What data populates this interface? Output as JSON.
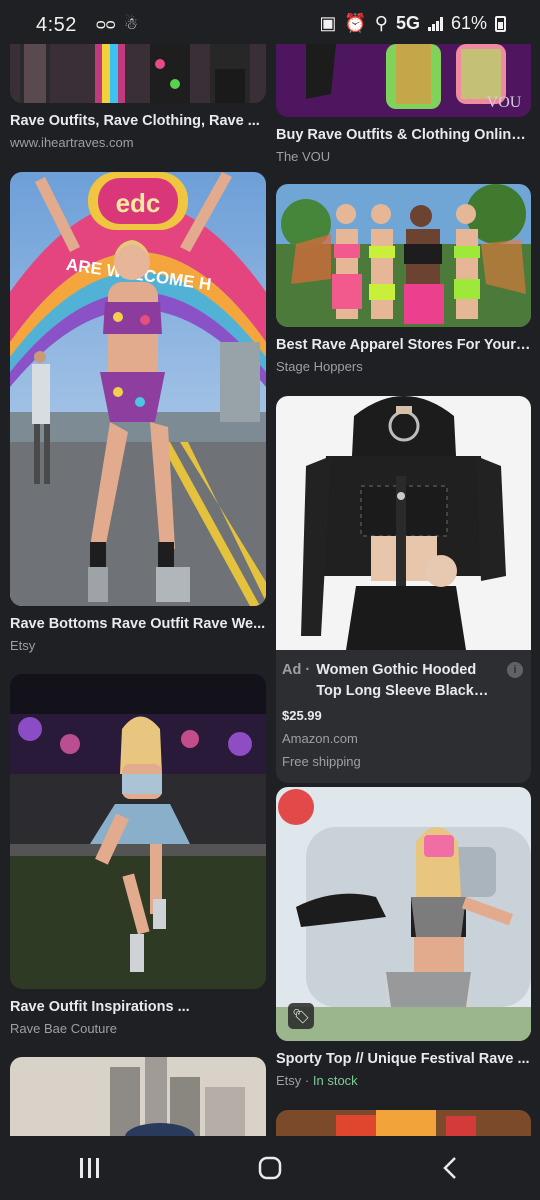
{
  "status_bar": {
    "time": "4:52",
    "network": "5G",
    "battery": "61%",
    "left_icons": [
      "voicemail-icon",
      "notification-icon"
    ],
    "right_icons": [
      "photo-icon",
      "alarm-icon",
      "location-icon",
      "signal-icon",
      "battery-icon"
    ]
  },
  "results": {
    "left": [
      {
        "title": "Rave Outfits, Rave Clothing, Rave ...",
        "source": "www.iheartraves.com"
      },
      {
        "title": "Rave Bottoms Rave Outfit Rave We...",
        "source": "Etsy"
      },
      {
        "title": "Rave Outfit Inspirations ...",
        "source": "Rave Bae Couture"
      }
    ],
    "right": [
      {
        "title": "Buy Rave Outfits & Clothing Online...",
        "source": "The VOU",
        "watermark": "VOU"
      },
      {
        "title": "Best Rave Apparel Stores For Your ...",
        "source": "Stage Hoppers"
      },
      {
        "ad_label": "Ad ·",
        "title": "Women Gothic Hooded Top Long Sleeve Black Chain...",
        "price": "$25.99",
        "store": "Amazon.com",
        "shipping": "Free shipping",
        "info_glyph": "i"
      },
      {
        "title": "Sporty Top // Unique Festival Rave ...",
        "source": "Etsy",
        "availability": "In stock"
      }
    ]
  },
  "thumb_labels": {
    "edc_logo": "edc",
    "arch_text": "ARE WELCOME H"
  },
  "navbar": [
    "recents-button",
    "home-button",
    "back-button"
  ]
}
